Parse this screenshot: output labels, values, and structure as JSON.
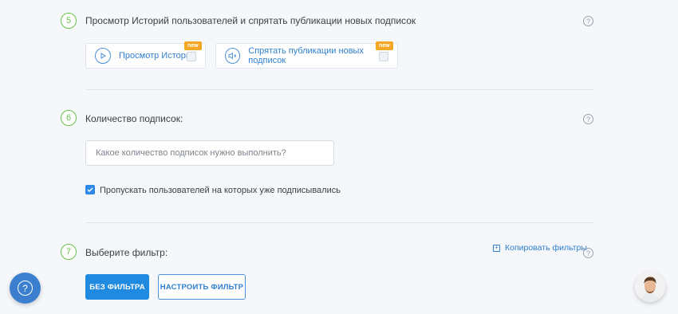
{
  "steps": [
    {
      "number": "5",
      "title": "Просмотр Историй пользователей и спрятать публикации новых подписок"
    },
    {
      "number": "6",
      "title": "Количество подписок:"
    },
    {
      "number": "7",
      "title": "Выберите фильтр:"
    }
  ],
  "help_glyph": "?",
  "options": [
    {
      "label": "Просмотр Историй",
      "badge": "new",
      "icon": "play-circle-icon"
    },
    {
      "label": "Спрятать публикации новых подписок",
      "badge": "new",
      "icon": "mute-speaker-icon"
    }
  ],
  "subscriptions": {
    "placeholder": "Какое количество подписок нужно выполнить?",
    "value": "",
    "skip_label": "Пропускать пользователей на которых уже подписывались",
    "skip_checked": true
  },
  "filter": {
    "copy_label": "Копировать фильтры",
    "no_filter_label": "БЕЗ ФИЛЬТРА",
    "configure_label": "НАСТРОИТЬ ФИЛЬТР"
  },
  "colors": {
    "accent": "#1f8ae0",
    "step_green": "#6bc04b",
    "badge": "#f5a623"
  }
}
